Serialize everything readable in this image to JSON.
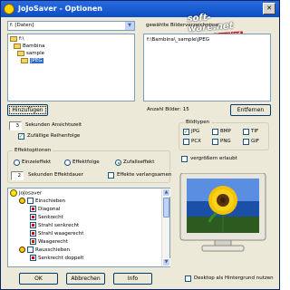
{
  "window": {
    "title": "JoJoSaver - Optionen"
  },
  "watermark": {
    "line1": "soft-ware.net",
    "line2": "Download"
  },
  "drive": {
    "value": "f: [Daten]"
  },
  "folders": [
    {
      "label": "f:\\",
      "selected": false
    },
    {
      "label": "Bambina",
      "selected": false
    },
    {
      "label": "sample",
      "selected": false
    },
    {
      "label": "JPEG",
      "selected": true
    }
  ],
  "chosen_folders": {
    "label": "gewählte Bilderverzeichnisse",
    "items": [
      "f:\\Bambina\\_sample\\JPEG"
    ]
  },
  "buttons": {
    "add": "Hinzufügen",
    "remove": "Entfernen",
    "ok": "OK",
    "cancel": "Abbrechen",
    "info": "Info"
  },
  "picture_count": "Anzahl Bilder: 15",
  "display": {
    "seconds_value": "3",
    "seconds_label": "Sekunden Ansichtszeit",
    "random_order": "Zufällige Reihenfolge"
  },
  "effects": {
    "title": "Effektoptionen",
    "single": "Einzeleffekt",
    "all": "Effektfolge",
    "random": "Zufallseffekt",
    "duration_value": "2",
    "duration_label": "Sekunden Effektdauer",
    "slow": "Effekte verlangsamen"
  },
  "tree": [
    {
      "label": "JoJosaver",
      "kind": "root",
      "indent": 0
    },
    {
      "label": "Einschieben",
      "kind": "group",
      "indent": 1
    },
    {
      "label": "Diagonal",
      "kind": "item",
      "indent": 2
    },
    {
      "label": "Senkrecht",
      "kind": "item",
      "indent": 2
    },
    {
      "label": "Strahl senkrecht",
      "kind": "item",
      "indent": 2
    },
    {
      "label": "Strahl waagerecht",
      "kind": "item",
      "indent": 2
    },
    {
      "label": "Waagerecht",
      "kind": "item",
      "indent": 2
    },
    {
      "label": "Rausschieben",
      "kind": "group",
      "indent": 1
    },
    {
      "label": "Senkrecht doppelt",
      "kind": "item",
      "indent": 2
    }
  ],
  "filetypes": {
    "title": "Bildtypen",
    "items": [
      {
        "label": "JPG",
        "checked": true
      },
      {
        "label": "BMP",
        "checked": false
      },
      {
        "label": "TIF",
        "checked": false
      },
      {
        "label": "PCX",
        "checked": false
      },
      {
        "label": "PNG",
        "checked": false
      },
      {
        "label": "GIF",
        "checked": false
      }
    ]
  },
  "enlarge": "vergrößern erlaubt",
  "desktop_bg": "Desktop als Hintergrund nutzen",
  "colors": {
    "titlebar": "#0b4ec4",
    "selection": "#316ac5",
    "check": "#21a121"
  }
}
